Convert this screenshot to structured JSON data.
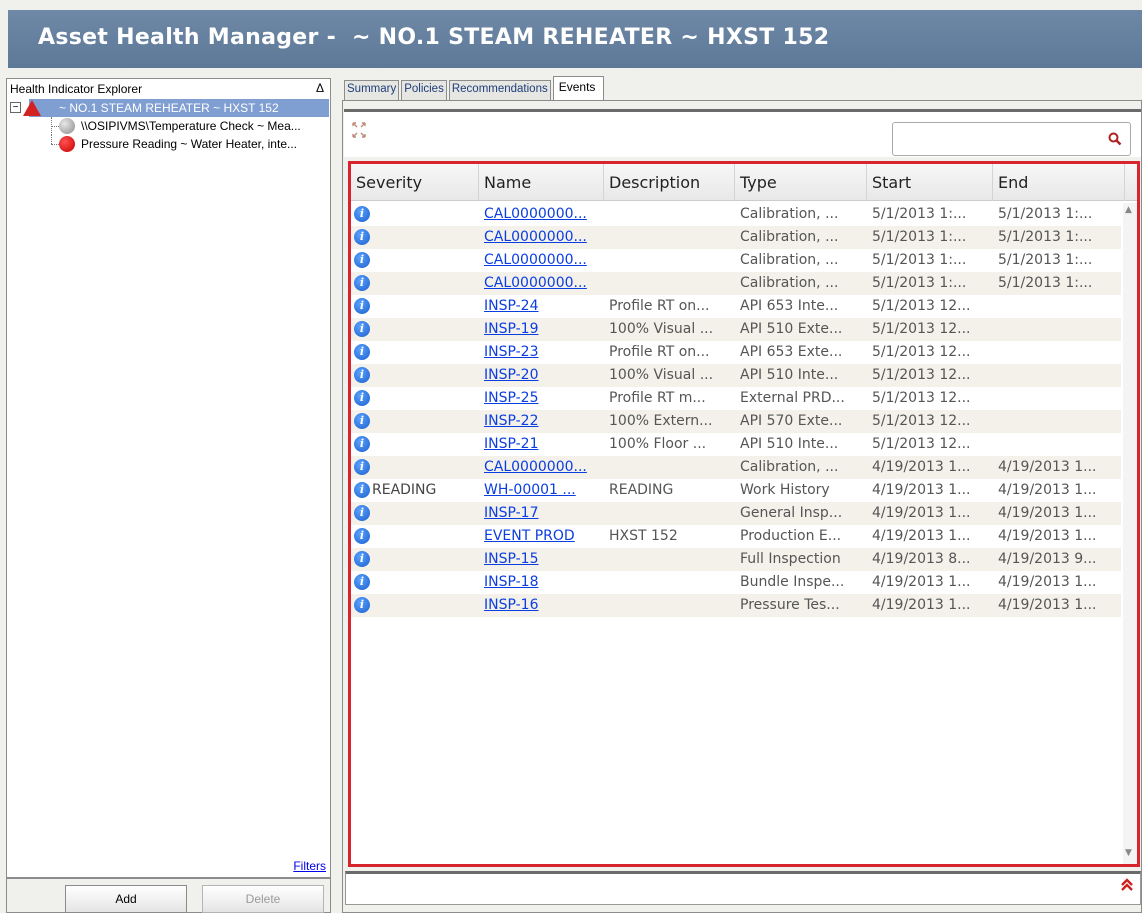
{
  "window": {
    "title": "Asset Health Manager -  ~ NO.1 STEAM REHEATER ~ HXST 152"
  },
  "explorer": {
    "header": "Health Indicator Explorer",
    "toggle_symbol": "Δ",
    "expander_symbol": "−",
    "root": {
      "label": "~ NO.1 STEAM REHEATER ~ HXST 152",
      "icon": "warning-triangle-icon",
      "color": "#d42222"
    },
    "children": [
      {
        "label": "\\\\OSIPIVMS\\Temperature Check ~ Mea...",
        "icon": "gray-status-dot-icon"
      },
      {
        "label": "Pressure Reading ~ Water Heater, inte...",
        "icon": "red-status-dot-icon"
      }
    ],
    "filters_label": "Filters",
    "add_label": "Add",
    "delete_label": "Delete"
  },
  "tabs": [
    {
      "label": "Summary",
      "active": false
    },
    {
      "label": "Policies",
      "active": false
    },
    {
      "label": "Recommendations",
      "active": false
    },
    {
      "label": "Events",
      "active": true
    }
  ],
  "grid": {
    "columns": [
      "Severity",
      "Name",
      "Description",
      "Type",
      "Start",
      "End"
    ],
    "rows": [
      {
        "severity": "",
        "name": "CAL0000000...",
        "description": "",
        "type": "Calibration, ...",
        "start": "5/1/2013 1:...",
        "end": "5/1/2013 1:..."
      },
      {
        "severity": "",
        "name": "CAL0000000...",
        "description": "",
        "type": "Calibration, ...",
        "start": "5/1/2013 1:...",
        "end": "5/1/2013 1:..."
      },
      {
        "severity": "",
        "name": "CAL0000000...",
        "description": "",
        "type": "Calibration, ...",
        "start": "5/1/2013 1:...",
        "end": "5/1/2013 1:..."
      },
      {
        "severity": "",
        "name": "CAL0000000...",
        "description": "",
        "type": "Calibration, ...",
        "start": "5/1/2013 1:...",
        "end": "5/1/2013 1:..."
      },
      {
        "severity": "",
        "name": "INSP-24",
        "description": "Profile RT on...",
        "type": "API 653 Inte...",
        "start": "5/1/2013 12...",
        "end": ""
      },
      {
        "severity": "",
        "name": "INSP-19",
        "description": "100% Visual ...",
        "type": "API 510 Exte...",
        "start": "5/1/2013 12...",
        "end": ""
      },
      {
        "severity": "",
        "name": "INSP-23",
        "description": "Profile RT on...",
        "type": "API 653 Exte...",
        "start": "5/1/2013 12...",
        "end": ""
      },
      {
        "severity": "",
        "name": "INSP-20",
        "description": "100% Visual ...",
        "type": "API 510 Inte...",
        "start": "5/1/2013 12...",
        "end": ""
      },
      {
        "severity": "",
        "name": "INSP-25",
        "description": "Profile RT m...",
        "type": "External PRD...",
        "start": "5/1/2013 12...",
        "end": ""
      },
      {
        "severity": "",
        "name": "INSP-22",
        "description": "100% Extern...",
        "type": "API 570 Exte...",
        "start": "5/1/2013 12...",
        "end": ""
      },
      {
        "severity": "",
        "name": "INSP-21",
        "description": "100% Floor ...",
        "type": "API 510 Inte...",
        "start": "5/1/2013 12...",
        "end": ""
      },
      {
        "severity": "",
        "name": "CAL0000000...",
        "description": "",
        "type": "Calibration, ...",
        "start": "4/19/2013 1...",
        "end": "4/19/2013 1..."
      },
      {
        "severity": "READING",
        "name": "WH-00001 ...",
        "description": "READING",
        "type": "Work History",
        "start": "4/19/2013 1...",
        "end": "4/19/2013 1..."
      },
      {
        "severity": "",
        "name": "INSP-17",
        "description": "",
        "type": "General Insp...",
        "start": "4/19/2013 1...",
        "end": "4/19/2013 1..."
      },
      {
        "severity": "",
        "name": "EVENT PROD",
        "description": "HXST 152",
        "type": "Production E...",
        "start": "4/19/2013 1...",
        "end": "4/19/2013 1..."
      },
      {
        "severity": "",
        "name": "INSP-15",
        "description": "",
        "type": "Full Inspection",
        "start": "4/19/2013 8...",
        "end": "4/19/2013 9..."
      },
      {
        "severity": "",
        "name": "INSP-18",
        "description": "",
        "type": "Bundle Inspe...",
        "start": "4/19/2013 1...",
        "end": "4/19/2013 1..."
      },
      {
        "severity": "",
        "name": "INSP-16",
        "description": "",
        "type": "Pressure Tes...",
        "start": "4/19/2013 1...",
        "end": "4/19/2013 1..."
      }
    ],
    "severity_icon": "info-icon",
    "severity_icon_glyph": "i"
  },
  "colors": {
    "title_bar": "#6e88a6",
    "selection": "#7f9ed2",
    "grid_border": "#d8242c",
    "link": "#0b3ee0"
  }
}
